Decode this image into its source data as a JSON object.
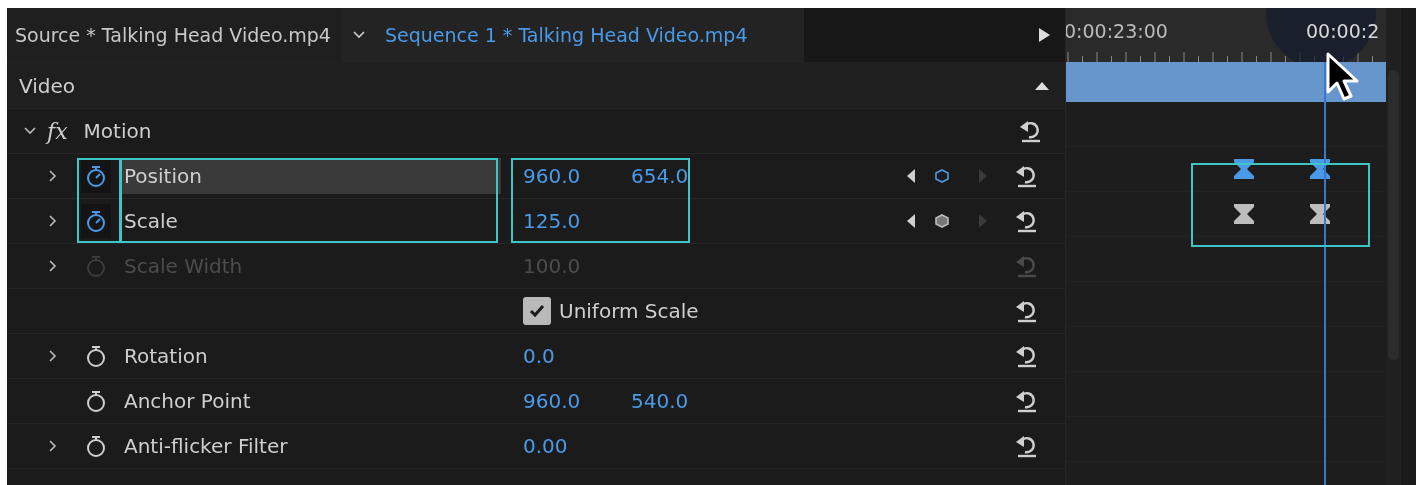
{
  "tabs": [
    {
      "label": "Source * Talking Head Video.mp4",
      "selected": false
    },
    {
      "label": "Sequence 1 * Talking Head Video.mp4",
      "selected": true
    }
  ],
  "section": {
    "label": "Video",
    "expanded": true
  },
  "effect": {
    "badge": "fx",
    "name": "Motion",
    "expanded": true
  },
  "properties": [
    {
      "kind": "param",
      "name": "Position",
      "expanded": false,
      "animating": true,
      "disabled": false,
      "highlighted": true,
      "values": [
        "960.0",
        "654.0"
      ],
      "keyframes": [
        {
          "selected": true
        },
        {
          "selected": true
        }
      ]
    },
    {
      "kind": "param",
      "name": "Scale",
      "expanded": false,
      "animating": true,
      "disabled": false,
      "highlighted": false,
      "values": [
        "125.0"
      ],
      "keyframes": [
        {
          "selected": false
        },
        {
          "selected": false
        }
      ]
    },
    {
      "kind": "param",
      "name": "Scale Width",
      "expanded": false,
      "animating": false,
      "disabled": true,
      "highlighted": false,
      "values": [
        "100.0"
      ]
    },
    {
      "kind": "checkbox",
      "label": "Uniform Scale",
      "checked": true
    },
    {
      "kind": "param",
      "name": "Rotation",
      "expanded": false,
      "animating": false,
      "disabled": false,
      "highlighted": false,
      "values": [
        "0.0"
      ]
    },
    {
      "kind": "param",
      "name": "Anchor Point",
      "animating": false,
      "disabled": false,
      "highlighted": false,
      "values": [
        "960.0",
        "540.0"
      ]
    },
    {
      "kind": "param",
      "name": "Anti-flicker Filter",
      "expanded": false,
      "animating": false,
      "disabled": false,
      "highlighted": false,
      "values": [
        "0.00"
      ]
    }
  ],
  "timeline": {
    "timecodes": [
      "0:00:23:00",
      "00:00:2"
    ]
  }
}
